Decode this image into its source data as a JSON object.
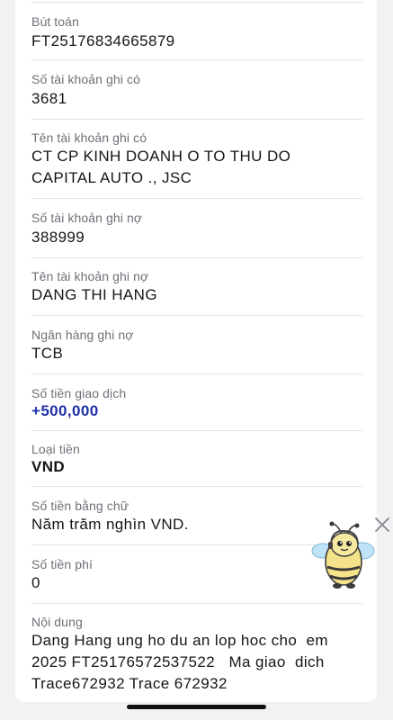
{
  "details": {
    "reference_label": "Bút toán",
    "reference_value": "FT25176834665879",
    "credit_account_no_label": "Số tài khoản ghi có",
    "credit_account_no_value": "3681",
    "credit_account_name_label": "Tên tài khoản ghi có",
    "credit_account_name_line1": "CT CP KINH DOANH O TO THU DO",
    "credit_account_name_line2": "CAPITAL AUTO ., JSC",
    "debit_account_no_label": "Số tài khoản ghi nợ",
    "debit_account_no_value": "388999",
    "debit_account_name_label": "Tên tài khoản ghi nợ",
    "debit_account_name_value": "DANG THI HANG",
    "debit_bank_label": "Ngân hàng ghi nợ",
    "debit_bank_value": "TCB",
    "amount_label": "Số tiền giao dịch",
    "amount_value": "+500,000",
    "currency_label": "Loại tiền",
    "currency_value": "VND",
    "amount_words_label": "Số tiền bằng chữ",
    "amount_words_value": "Năm trăm nghìn VND.",
    "fee_label": "Số tiền phí",
    "fee_value": "0",
    "content_label": "Nội dung",
    "content_line1": "Dang Hang ung ho du an lop hoc cho  em",
    "content_line2": "2025 FT25176572537522   Ma giao  dich",
    "content_line3": "Trace672932 Trace 672932"
  },
  "colors": {
    "amount": "#1f32a8",
    "label": "#6f6f78",
    "value": "#16161a",
    "background": "#f2f2f4"
  },
  "icons": {
    "close": "close-icon",
    "mascot": "bee-mascot"
  }
}
